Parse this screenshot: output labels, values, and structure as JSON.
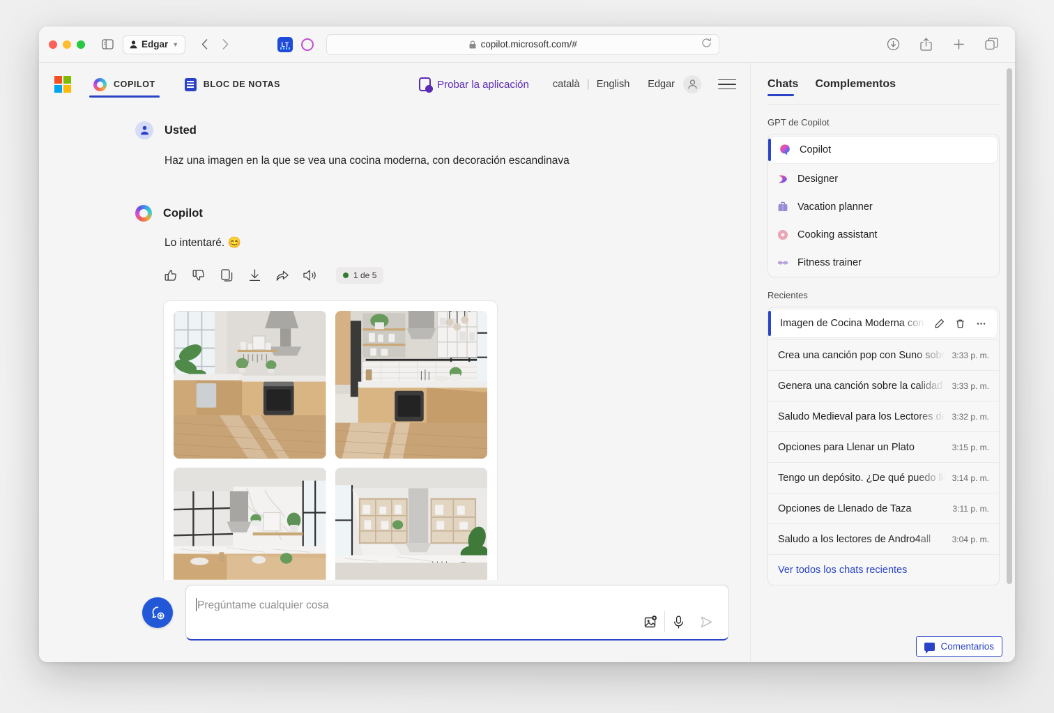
{
  "browser": {
    "profile_name": "Edgar",
    "url": "copilot.microsoft.com/#",
    "icons": {
      "sidebar_toggle": "sidebar-toggle-icon",
      "back": "back-arrow-icon",
      "forward": "forward-arrow-icon",
      "extension_languagetool": "LT",
      "extension_circle": "circle-extension-icon",
      "lock": "lock-icon",
      "reload": "reload-icon",
      "downloads": "downloads-icon",
      "share": "share-icon",
      "new_tab": "plus-icon",
      "tab_overview": "tab-overview-icon"
    }
  },
  "app_header": {
    "logo": "microsoft-logo",
    "tabs": [
      {
        "label": "COPILOT",
        "icon": "copilot-icon",
        "active": true
      },
      {
        "label": "BLOC DE NOTAS",
        "icon": "notepad-icon",
        "active": false
      }
    ],
    "try_app_label": "Probar la aplicación",
    "lang_primary": "català",
    "lang_separator": "|",
    "lang_secondary": "English",
    "user_name": "Edgar",
    "avatar": "person-icon",
    "menu": "hamburger-menu-icon"
  },
  "conversation": {
    "messages": [
      {
        "author": "Usted",
        "avatar": "user-avatar-icon",
        "text": "Haz una imagen en la que se vea una cocina moderna, con decoración escandinava"
      },
      {
        "author": "Copilot",
        "avatar": "copilot-avatar-icon",
        "text": "Lo intentaré. 😊"
      }
    ],
    "actions": [
      "thumbs-up-icon",
      "thumbs-down-icon",
      "copy-icon",
      "download-icon",
      "share-icon",
      "speaker-icon"
    ],
    "count_badge": "1 de 5",
    "count_badge_status_color": "#2f7d32",
    "image_results": [
      {
        "alt": "cocina-moderna-escandinava-1"
      },
      {
        "alt": "cocina-moderna-escandinava-2"
      },
      {
        "alt": "cocina-moderna-escandinava-3"
      },
      {
        "alt": "cocina-moderna-escandinava-4"
      }
    ]
  },
  "composer": {
    "new_chat_icon": "new-chat-plus-icon",
    "placeholder": "Pregúntame cualquier cosa",
    "value": "",
    "tools": [
      "add-image-icon",
      "microphone-icon",
      "send-icon"
    ]
  },
  "sidebar": {
    "tabs": [
      {
        "label": "Chats",
        "active": true
      },
      {
        "label": "Complementos",
        "active": false
      }
    ],
    "gpt_section_label": "GPT de Copilot",
    "gpts": [
      {
        "label": "Copilot",
        "icon": "copilot-icon",
        "active": true
      },
      {
        "label": "Designer",
        "icon": "designer-icon",
        "active": false
      },
      {
        "label": "Vacation planner",
        "icon": "suitcase-icon",
        "active": false
      },
      {
        "label": "Cooking assistant",
        "icon": "donut-icon",
        "active": false
      },
      {
        "label": "Fitness trainer",
        "icon": "dumbbell-icon",
        "active": false
      }
    ],
    "recent_section_label": "Recientes",
    "recents": [
      {
        "title": "Imagen de Cocina Moderna con De",
        "time": "",
        "active": true,
        "tools": [
          "edit-icon",
          "delete-icon",
          "more-options-icon"
        ]
      },
      {
        "title": "Crea una canción pop con Suno sobre",
        "time": "3:33 p. m.",
        "active": false
      },
      {
        "title": "Genera una canción sobre la calidad d",
        "time": "3:33 p. m.",
        "active": false
      },
      {
        "title": "Saludo Medieval para los Lectores de",
        "time": "3:32 p. m.",
        "active": false
      },
      {
        "title": "Opciones para Llenar un Plato",
        "time": "3:15 p. m.",
        "active": false
      },
      {
        "title": "Tengo un depósito. ¿De qué puedo lle",
        "time": "3:14 p. m.",
        "active": false
      },
      {
        "title": "Opciones de Llenado de Taza",
        "time": "3:11 p. m.",
        "active": false
      },
      {
        "title": "Saludo a los lectores de Andro4all",
        "time": "3:04 p. m.",
        "active": false
      }
    ],
    "see_all_label": "Ver todos los chats recientes"
  },
  "feedback": {
    "label": "Comentarios",
    "icon": "comment-icon"
  },
  "colors": {
    "accent": "#2b44c7",
    "purple": "#5b2ab5",
    "blue_button": "#2258d8",
    "status_green": "#2f7d32"
  }
}
